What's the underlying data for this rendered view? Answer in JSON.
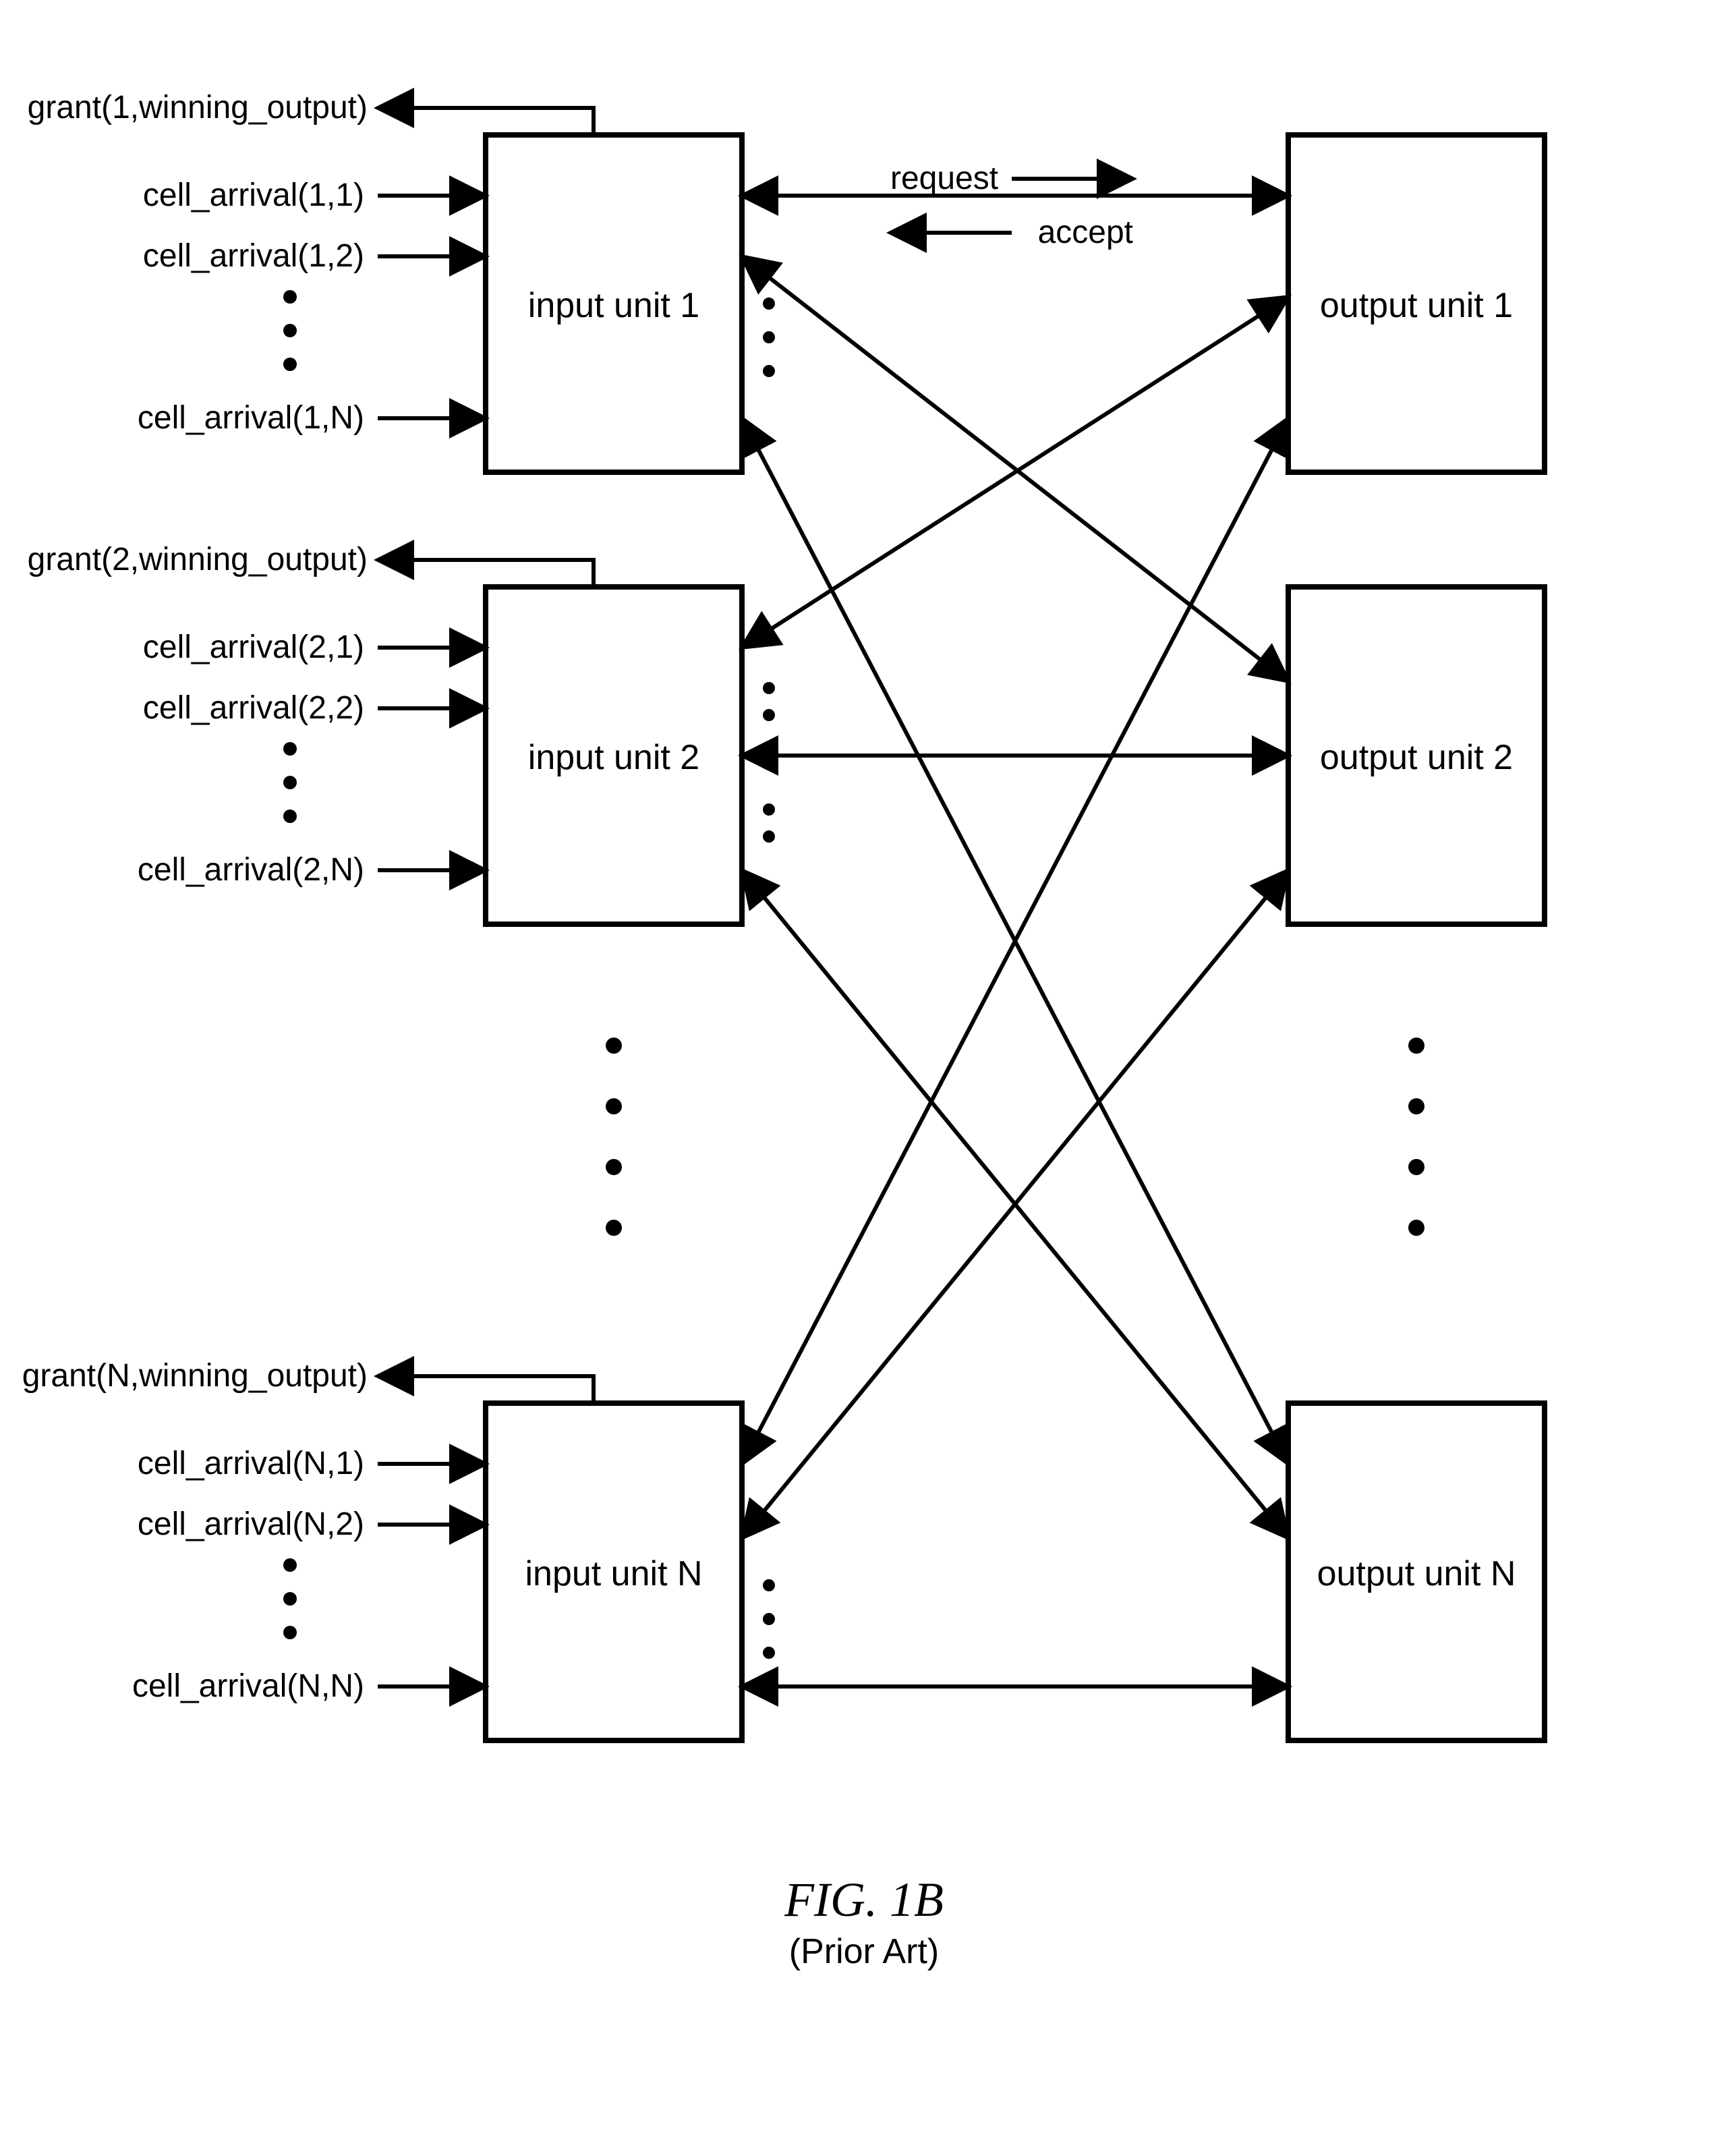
{
  "figure": {
    "title": "FIG. 1B",
    "subtitle": "(Prior Art)"
  },
  "legend": {
    "request": "request",
    "accept": "accept"
  },
  "input_units": [
    {
      "label": "input unit 1",
      "grant": "grant(1,winning_output)",
      "cells": [
        "cell_arrival(1,1)",
        "cell_arrival(1,2)",
        "cell_arrival(1,N)"
      ]
    },
    {
      "label": "input unit 2",
      "grant": "grant(2,winning_output)",
      "cells": [
        "cell_arrival(2,1)",
        "cell_arrival(2,2)",
        "cell_arrival(2,N)"
      ]
    },
    {
      "label": "input unit N",
      "grant": "grant(N,winning_output)",
      "cells": [
        "cell_arrival(N,1)",
        "cell_arrival(N,2)",
        "cell_arrival(N,N)"
      ]
    }
  ],
  "output_units": [
    {
      "label": "output unit 1"
    },
    {
      "label": "output unit 2"
    },
    {
      "label": "output unit N"
    }
  ]
}
